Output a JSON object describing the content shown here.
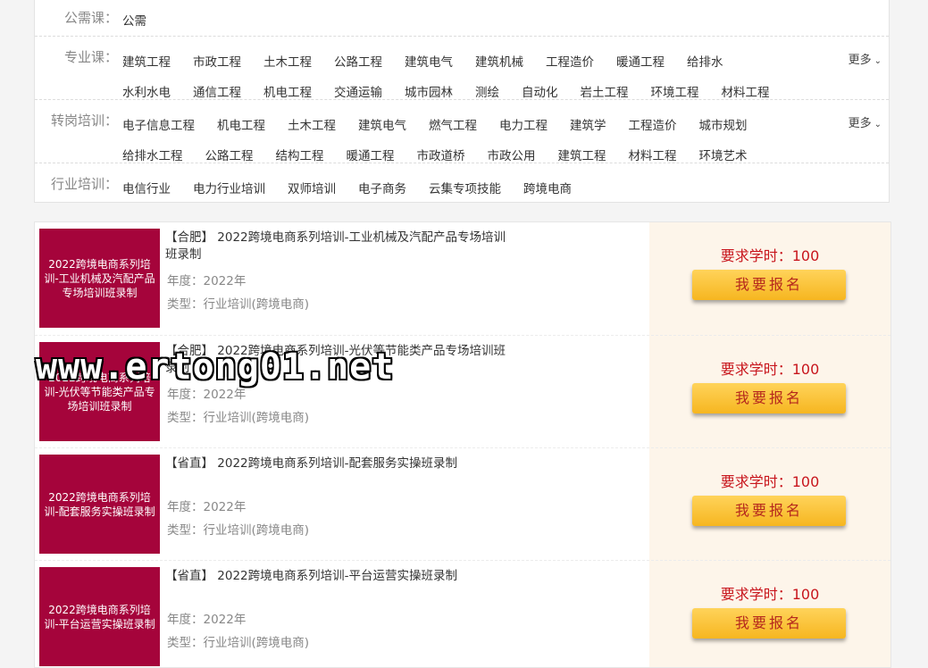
{
  "filters": {
    "gongxu": {
      "label": "公需课：",
      "items": [
        "公需"
      ]
    },
    "zhuanye": {
      "label": "专业课：",
      "line1": [
        "建筑工程",
        "市政工程",
        "土木工程",
        "公路工程",
        "建筑电气",
        "建筑机械",
        "工程造价",
        "暖通工程",
        "给排水"
      ],
      "line2": [
        "水利水电",
        "通信工程",
        "机电工程",
        "交通运输",
        "城市园林",
        "测绘",
        "自动化",
        "岩土工程",
        "环境工程",
        "材料工程"
      ],
      "more": "更多"
    },
    "zhuangang": {
      "label": "转岗培训：",
      "line1": [
        "电子信息工程",
        "机电工程",
        "土木工程",
        "建筑电气",
        "燃气工程",
        "电力工程",
        "建筑学",
        "工程造价",
        "城市规划"
      ],
      "line2": [
        "给排水工程",
        "公路工程",
        "结构工程",
        "暖通工程",
        "市政道桥",
        "市政公用",
        "建筑工程",
        "材料工程",
        "环境艺术"
      ],
      "more": "更多"
    },
    "hangye": {
      "label": "行业培训：",
      "line1": [
        "电信行业",
        "电力行业培训",
        "双师培训",
        "电子商务",
        "云集专项技能",
        "跨境电商"
      ]
    }
  },
  "courses": [
    {
      "thumb": "2022跨境电商系列培训-工业机械及汽配产品专场培训班录制",
      "title": "【合肥】 2022跨境电商系列培训-工业机械及汽配产品专场培训班录制",
      "year": "年度：2022年",
      "type": "类型：行业培训(跨境电商)",
      "req": "要求学时：100",
      "button": "我要报名"
    },
    {
      "thumb": "2022跨境电商系列培训-光伏等节能类产品专场培训班录制",
      "title": "【合肥】 2022跨境电商系列培训-光伏等节能类产品专场培训班录制",
      "year": "年度：2022年",
      "type": "类型：行业培训(跨境电商)",
      "req": "要求学时：100",
      "button": "我要报名"
    },
    {
      "thumb": "2022跨境电商系列培训-配套服务实操班录制",
      "title": "【省直】 2022跨境电商系列培训-配套服务实操班录制",
      "year": "年度：2022年",
      "type": "类型：行业培训(跨境电商)",
      "req": "要求学时：100",
      "button": "我要报名"
    },
    {
      "thumb": "2022跨境电商系列培训-平台运营实操班录制",
      "title": "【省直】 2022跨境电商系列培训-平台运营实操班录制",
      "year": "年度：2022年",
      "type": "类型：行业培训(跨境电商)",
      "req": "要求学时：100",
      "button": "我要报名"
    }
  ],
  "watermark": "www.ertong01.net",
  "colors": {
    "thumb_bg": "#a5043b",
    "button": "#f7bd2c",
    "req_text": "#c8161d",
    "right_panel": "#fdf5ea"
  }
}
